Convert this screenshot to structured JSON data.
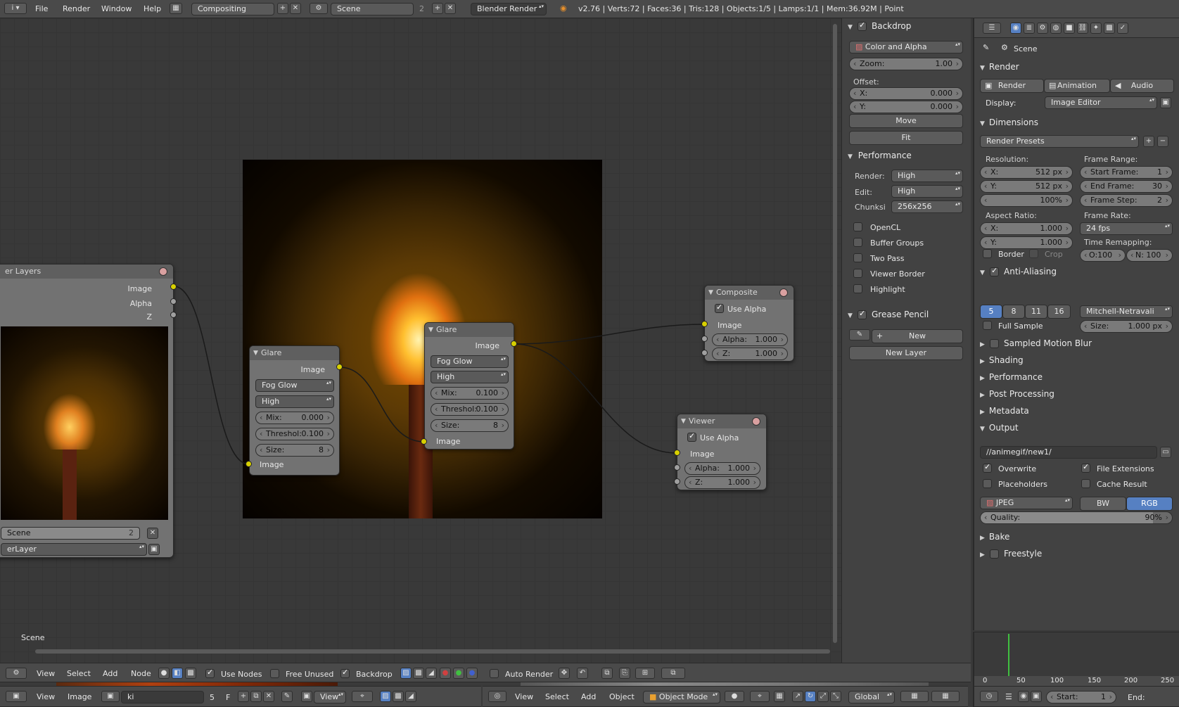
{
  "info_header": {
    "menus": [
      "File",
      "Render",
      "Window",
      "Help"
    ],
    "screen_layout": "Compositing",
    "scene": "Scene",
    "scene_users": "2",
    "engine": "Blender Render",
    "stats": "v2.76 | Verts:72 | Faces:36 | Tris:128 | Objects:1/5 | Lamps:1/1 | Mem:36.92M | Point"
  },
  "node_editor": {
    "scene_label": "Scene",
    "render_layers_node": {
      "title": "er Layers",
      "outputs": [
        "Image",
        "Alpha",
        "Z"
      ],
      "scene": "Scene",
      "scene_users": "2",
      "layer": "erLayer"
    },
    "glare1": {
      "title": "Glare",
      "output": "Image",
      "type": "Fog Glow",
      "quality": "High",
      "mix_label": "Mix:",
      "mix": "0.000",
      "threshold_label": "Threshol:",
      "threshold": "0.100",
      "size_label": "Size:",
      "size": "8",
      "input": "Image"
    },
    "glare2": {
      "title": "Glare",
      "output": "Image",
      "type": "Fog Glow",
      "quality": "High",
      "mix_label": "Mix:",
      "mix": "0.100",
      "threshold_label": "Threshol:",
      "threshold": "0.100",
      "size_label": "Size:",
      "size": "8",
      "input": "Image"
    },
    "composite": {
      "title": "Composite",
      "use_alpha": "Use Alpha",
      "image": "Image",
      "alpha_label": "Alpha:",
      "alpha": "1.000",
      "z_label": "Z:",
      "z": "1.000"
    },
    "viewer": {
      "title": "Viewer",
      "use_alpha": "Use Alpha",
      "image": "Image",
      "alpha_label": "Alpha:",
      "alpha": "1.000",
      "z_label": "Z:",
      "z": "1.000"
    }
  },
  "node_sidebar": {
    "backdrop": "Backdrop",
    "channels": "Color and Alpha",
    "zoom_label": "Zoom:",
    "zoom": "1.00",
    "offset": "Offset:",
    "x_label": "X:",
    "x": "0.000",
    "y_label": "Y:",
    "y": "0.000",
    "move": "Move",
    "fit": "Fit",
    "performance": "Performance",
    "render_label": "Render:",
    "render": "High",
    "edit_label": "Edit:",
    "edit": "High",
    "chunks_label": "Chunksi",
    "chunks": "256x256",
    "opencl": "OpenCL",
    "buffer_groups": "Buffer Groups",
    "two_pass": "Two Pass",
    "viewer_border": "Viewer Border",
    "highlight": "Highlight",
    "grease_pencil": "Grease Pencil",
    "new": "New",
    "new_layer": "New Layer"
  },
  "node_footer": {
    "menus": [
      "View",
      "Select",
      "Add",
      "Node"
    ],
    "use_nodes": "Use Nodes",
    "free_unused": "Free Unused",
    "backdrop": "Backdrop",
    "auto_render": "Auto Render"
  },
  "image_footer": {
    "menus": [
      "View",
      "Image"
    ],
    "image_name": "ki",
    "users": "5",
    "fake": "F",
    "view": "View"
  },
  "view3d_footer": {
    "menus": [
      "View",
      "Select",
      "Add",
      "Object"
    ],
    "mode": "Object Mode",
    "orientation": "Global"
  },
  "properties": {
    "context": "Scene",
    "render_panel": "Render",
    "render_btn": "Render",
    "animation_btn": "Animation",
    "audio_btn": "Audio",
    "display_label": "Display:",
    "display": "Image Editor",
    "dimensions": "Dimensions",
    "render_presets": "Render Presets",
    "resolution": "Resolution:",
    "res_x_label": "X:",
    "res_x": "512 px",
    "res_y_label": "Y:",
    "res_y": "512 px",
    "res_pct": "100%",
    "frame_range": "Frame Range:",
    "start_label": "Start Frame:",
    "start": "1",
    "end_label": "End Frame:",
    "end": "30",
    "step_label": "Frame Step:",
    "step": "2",
    "aspect": "Aspect Ratio:",
    "asp_x_label": "X:",
    "asp_x": "1.000",
    "asp_y_label": "Y:",
    "asp_y": "1.000",
    "frame_rate": "Frame Rate:",
    "fps": "24 fps",
    "border": "Border",
    "crop": "Crop",
    "time_remap": "Time Remapping:",
    "o": "O:100",
    "n": "N: 100",
    "anti_aliasing": "Anti-Aliasing",
    "aa_samples": [
      "5",
      "8",
      "11",
      "16"
    ],
    "aa_filter": "Mitchell-Netravali",
    "full_sample": "Full Sample",
    "aa_size_label": "Size:",
    "aa_size": "1.000 px",
    "sampled_motion_blur": "Sampled Motion Blur",
    "shading": "Shading",
    "performance": "Performance",
    "post_processing": "Post Processing",
    "metadata": "Metadata",
    "output": "Output",
    "output_path": "//animegif/new1/",
    "overwrite": "Overwrite",
    "file_extensions": "File Extensions",
    "placeholders": "Placeholders",
    "cache_result": "Cache Result",
    "format": "JPEG",
    "bw": "BW",
    "rgb": "RGB",
    "quality_label": "Quality:",
    "quality": "90%",
    "bake": "Bake",
    "freestyle": "Freestyle"
  },
  "timeline": {
    "ticks": [
      "0",
      "50",
      "100",
      "150",
      "200",
      "250"
    ],
    "start_label": "Start:",
    "start": "1",
    "end_label": "End:"
  },
  "colors": {
    "accent_blue": "#5680c2",
    "socket_yellow": "#d8d000",
    "frame_green": "#40c040"
  }
}
